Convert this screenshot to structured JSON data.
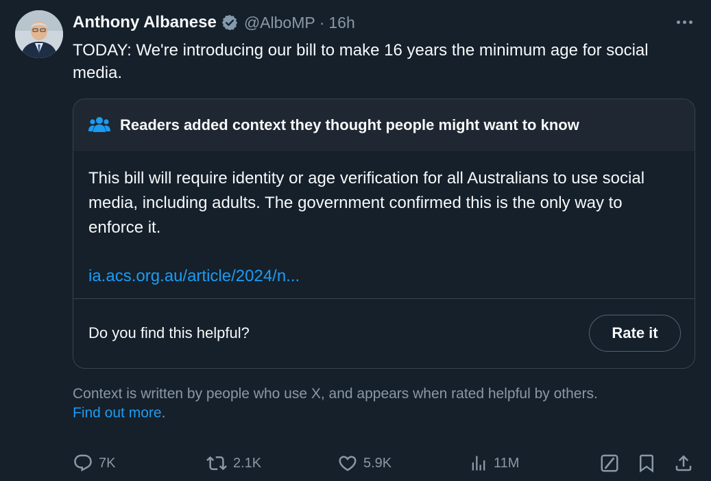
{
  "author": {
    "display_name": "Anthony Albanese",
    "handle": "@AlboMP",
    "separator": "·",
    "time": "16h",
    "verified": true
  },
  "tweet": {
    "text": "TODAY: We're introducing our bill to make 16 years the minimum age for social media."
  },
  "community_note": {
    "title": "Readers added context they thought people might want to know",
    "body": "This bill will require identity or age verification for all Australians to use social media, including adults. The government confirmed this is the only way to enforce it.",
    "link": "ia.acs.org.au/article/2024/n...",
    "question": "Do you find this helpful?",
    "rate_label": "Rate it"
  },
  "context_info": {
    "text": "Context is written by people who use X, and appears when rated helpful by others.",
    "link_label": "Find out more",
    "suffix": "."
  },
  "actions": {
    "replies": "7K",
    "reposts": "2.1K",
    "likes": "5.9K",
    "views": "11M"
  },
  "colors": {
    "background": "#15202b",
    "accent": "#1d9bf0",
    "muted": "#8b98a5",
    "border": "#38444d"
  }
}
